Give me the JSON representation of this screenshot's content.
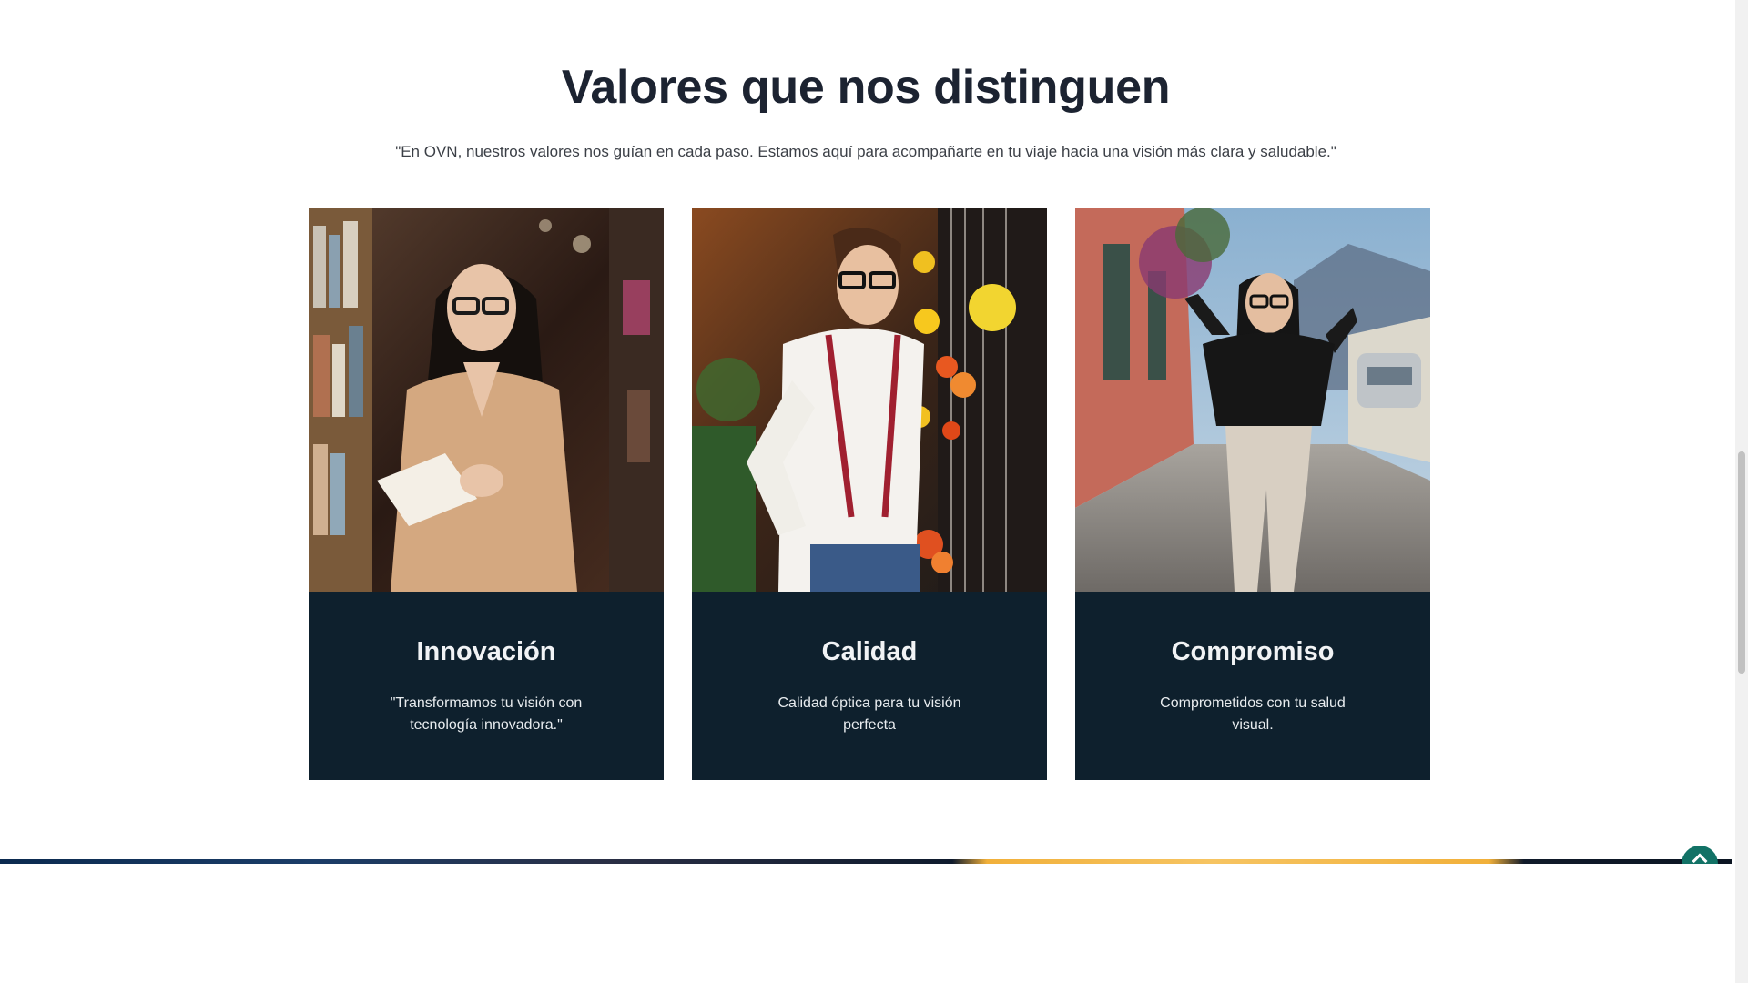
{
  "section": {
    "title": "Valores que nos distinguen",
    "subtitle": "\"En OVN, nuestros valores nos guían en cada paso. Estamos aquí para acompañarte en tu viaje hacia una visión más clara y saludable.\""
  },
  "cards": [
    {
      "title": "Innovación",
      "text": "\"Transformamos tu visión con tecnología innovadora.\"",
      "image_icon": "woman-reading-book-photo"
    },
    {
      "title": "Calidad",
      "text": "Calidad óptica para tu visión perfecta",
      "image_icon": "man-with-glasses-flowers-photo"
    },
    {
      "title": "Compromiso",
      "text": "Comprometidos con tu salud visual.",
      "image_icon": "woman-on-street-photo"
    }
  ],
  "colors": {
    "title": "#1c2331",
    "card_background": "#0e202d",
    "accent_teal": "#127266",
    "banner_gold": "#f1b03a"
  },
  "scroll_to_top_icon": "chevron-up-icon"
}
